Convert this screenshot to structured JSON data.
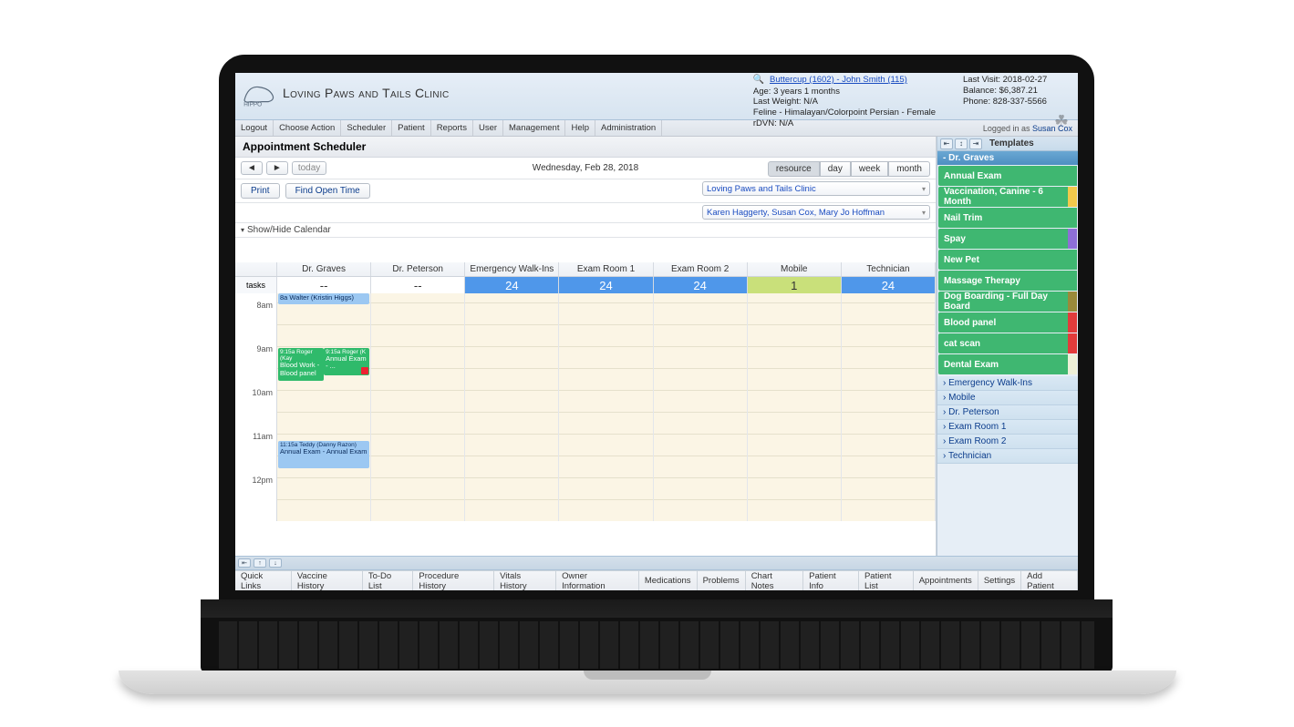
{
  "clinic_name": "Loving Paws and Tails Clinic",
  "patient_link": "Buttercup (1602) - John Smith (115)",
  "patient_info": {
    "age": "Age: 3 years 1 months",
    "last_weight": "Last Weight: N/A",
    "species": "Feline - Himalayan/Colorpoint Persian - Female",
    "rdvn": "rDVN: N/A"
  },
  "account_info": {
    "last_visit": "Last Visit: 2018-02-27",
    "balance": "Balance:   $6,387.21",
    "phone": "Phone: 828-337-5566"
  },
  "menubar": [
    "Logout",
    "Choose Action",
    "Scheduler",
    "Patient",
    "Reports",
    "User",
    "Management",
    "Help",
    "Administration"
  ],
  "login_prefix": "Logged in as ",
  "login_user": "Susan Cox",
  "section_title": "Appointment Scheduler",
  "nav": {
    "prev": "◄",
    "next": "►",
    "today": "today"
  },
  "date_label": "Wednesday, Feb 28, 2018",
  "views": {
    "resource": "resource",
    "day": "day",
    "week": "week",
    "month": "month"
  },
  "actions": {
    "print": "Print",
    "find_open": "Find Open Time"
  },
  "dropdowns": {
    "clinic": "Loving Paws and Tails Clinic",
    "staff": "Karen Haggerty, Susan Cox, Mary Jo Hoffman"
  },
  "show_hide": "Show/Hide Calendar",
  "columns": [
    "Dr. Graves",
    "Dr. Peterson",
    "Emergency Walk-Ins",
    "Exam Room 1",
    "Exam Room 2",
    "Mobile",
    "Technician"
  ],
  "tasks_label": "tasks",
  "counts": [
    "--",
    "--",
    "24",
    "24",
    "24",
    "1",
    "24"
  ],
  "times": [
    "8am",
    "9am",
    "10am",
    "11am",
    "12pm"
  ],
  "appointments": {
    "graves_8a": "8a Walter (Kristin Higgs)",
    "graves_915a_1_hdr": "9:15a Roger (Kay",
    "graves_915a_1_body": "Blood Work - Blood panel",
    "graves_915a_2_hdr": "9:15a Roger (K",
    "graves_915a_2_body": "Annual Exam - ...",
    "graves_1115a_hdr": "11:15a Teddy (Danny Razon)",
    "graves_1115a_body": "Annual Exam - Annual Exam"
  },
  "templates_label": "Templates",
  "templates_header": "- Dr. Graves",
  "templates": [
    {
      "label": "Annual Exam",
      "stripe": "#3fb771"
    },
    {
      "label": "Vaccination, Canine - 6 Month",
      "stripe": "#f2c94c"
    },
    {
      "label": "Nail Trim",
      "stripe": "#3fb771"
    },
    {
      "label": "Spay",
      "stripe": "#8e6fd6"
    },
    {
      "label": "New Pet",
      "stripe": "#3fb771"
    },
    {
      "label": "Massage Therapy",
      "stripe": "#3fb771"
    },
    {
      "label": "Dog Boarding - Full Day Board",
      "stripe": "#9a8a3a"
    },
    {
      "label": "Blood panel",
      "stripe": "#e23b3b"
    },
    {
      "label": "cat scan",
      "stripe": "#e23b3b"
    },
    {
      "label": "Dental Exam",
      "stripe": "#eef0d8"
    }
  ],
  "template_groups": [
    "Emergency Walk-Ins",
    "Mobile",
    "Dr. Peterson",
    "Exam Room 1",
    "Exam Room 2",
    "Technician"
  ],
  "bottom_tabs": [
    "Quick Links",
    "Vaccine History",
    "To-Do List",
    "Procedure History",
    "Vitals History",
    "Owner Information",
    "Medications",
    "Problems",
    "Chart Notes",
    "Patient Info",
    "Patient List",
    "Appointments",
    "Settings",
    "Add Patient"
  ]
}
